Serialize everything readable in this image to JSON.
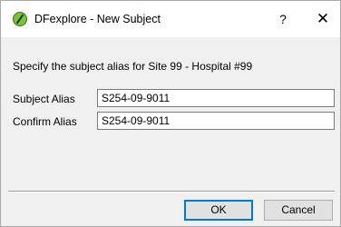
{
  "window": {
    "title": "DFexplore - New Subject",
    "help_label": "?",
    "close_label": "✕",
    "icon": "dfexplore-app-icon"
  },
  "dialog": {
    "prompt": "Specify the subject alias for Site 99 - Hospital #99",
    "fields": {
      "subject_alias": {
        "label": "Subject Alias",
        "value": "S254-09-9011"
      },
      "confirm_alias": {
        "label": "Confirm Alias",
        "value": "S254-09-9011"
      }
    }
  },
  "buttons": {
    "ok_label": "OK",
    "cancel_label": "Cancel"
  },
  "colors": {
    "titlebar_bg": "#ffffff",
    "dialog_bg": "#f0f0f0",
    "default_button_border": "#0078d7"
  }
}
